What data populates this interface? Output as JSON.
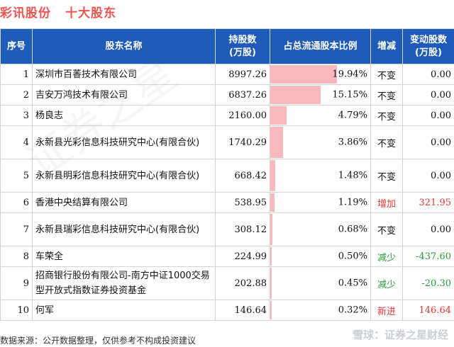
{
  "title": {
    "company": "彩讯股份",
    "subtitle": "十大股东"
  },
  "columns": {
    "index": "序号",
    "name": "股东名称",
    "holdings_line1": "持股数",
    "holdings_line2": "(万股)",
    "ratio": "占总流通股本比例",
    "change": "增减",
    "delta_line1": "变动股数",
    "delta_line2": "(万股)"
  },
  "rows": [
    {
      "index": "1",
      "name": "深圳市百萫技术有限公司",
      "holdings": "8997.26",
      "ratio": "19.94%",
      "ratio_value": 19.94,
      "change": "不变",
      "change_type": "same",
      "delta": "0.00"
    },
    {
      "index": "2",
      "name": "吉安万鸿技术有限公司",
      "holdings": "6837.26",
      "ratio": "15.15%",
      "ratio_value": 15.15,
      "change": "不变",
      "change_type": "same",
      "delta": "0.00"
    },
    {
      "index": "3",
      "name": "杨良志",
      "holdings": "2160.00",
      "ratio": "4.79%",
      "ratio_value": 4.79,
      "change": "不变",
      "change_type": "same",
      "delta": "0.00"
    },
    {
      "index": "4",
      "name": "永新县光彩信息科技研究中心(有限合伙)",
      "holdings": "1740.29",
      "ratio": "3.86%",
      "ratio_value": 3.86,
      "change": "不变",
      "change_type": "same",
      "delta": "0.00"
    },
    {
      "index": "5",
      "name": "永新县明彩信息科技研究中心(有限合伙)",
      "holdings": "668.42",
      "ratio": "1.48%",
      "ratio_value": 1.48,
      "change": "不变",
      "change_type": "same",
      "delta": "0.00"
    },
    {
      "index": "6",
      "name": "香港中央结算有限公司",
      "holdings": "538.95",
      "ratio": "1.19%",
      "ratio_value": 1.19,
      "change": "增加",
      "change_type": "up",
      "delta": "321.95"
    },
    {
      "index": "7",
      "name": "永新县瑞彩信息科技研究中心(有限合伙)",
      "holdings": "308.12",
      "ratio": "0.68%",
      "ratio_value": 0.68,
      "change": "不变",
      "change_type": "same",
      "delta": "0.00"
    },
    {
      "index": "8",
      "name": "车荣全",
      "holdings": "224.99",
      "ratio": "0.50%",
      "ratio_value": 0.5,
      "change": "减少",
      "change_type": "down",
      "delta": "-437.60"
    },
    {
      "index": "9",
      "name": "招商银行股份有限公司-南方中证1000交易型开放式指数证券投资基金",
      "holdings": "202.88",
      "ratio": "0.45%",
      "ratio_value": 0.45,
      "change": "减少",
      "change_type": "down",
      "delta": "-20.30"
    },
    {
      "index": "10",
      "name": "何军",
      "holdings": "146.64",
      "ratio": "0.32%",
      "ratio_value": 0.32,
      "change": "新进",
      "change_type": "up",
      "delta": "146.64"
    }
  ],
  "footer": {
    "source": "数据来源：公开数据整理，仅供参考不构成投资建议",
    "brand": "雪球：证券之星财经"
  },
  "colors": {
    "header_bg": "#1f5bb8",
    "title": "#ef5350",
    "bar": "#f8b8bd",
    "up": "#e53935",
    "down": "#2e9a3a"
  }
}
